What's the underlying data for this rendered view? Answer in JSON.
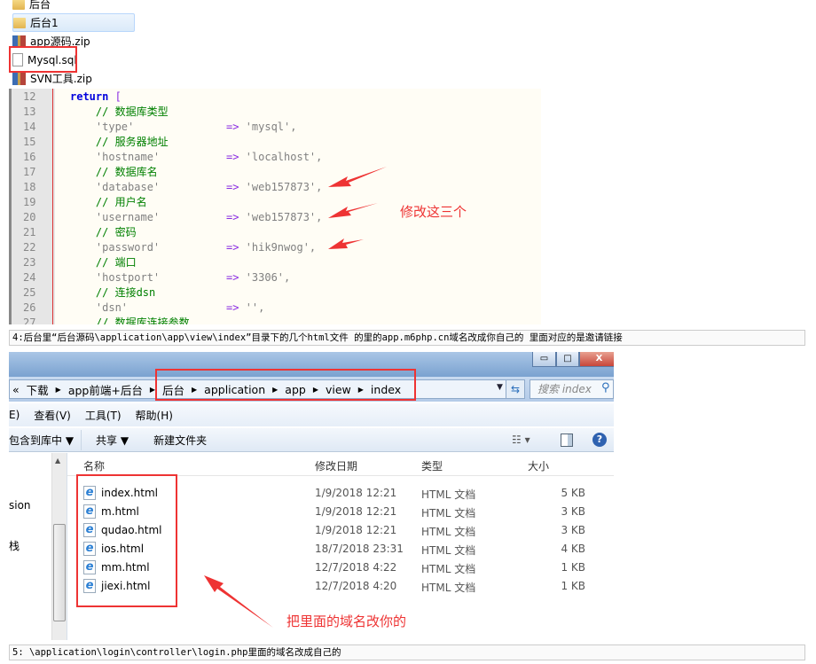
{
  "file_list": [
    {
      "name": "后台",
      "icon": "folder-icon"
    },
    {
      "name": "后台1",
      "icon": "folder-icon",
      "selected": true
    },
    {
      "name": "app源码.zip",
      "icon": "zip-icon"
    },
    {
      "name": "Mysql.sql",
      "icon": "file-icon",
      "highlighted": true
    },
    {
      "name": "SVN工具.zip",
      "icon": "zip-icon"
    }
  ],
  "code": {
    "lines": [
      {
        "n": "12",
        "t": "kw",
        "text": "return",
        "extra": " ["
      },
      {
        "n": "13",
        "t": "cm",
        "text": "    // 数据库类型"
      },
      {
        "n": "14",
        "t": "kv",
        "key": "    'type'",
        "val": "'mysql',"
      },
      {
        "n": "15",
        "t": "cm",
        "text": "    // 服务器地址"
      },
      {
        "n": "16",
        "t": "kv",
        "key": "    'hostname'",
        "val": "'localhost',"
      },
      {
        "n": "17",
        "t": "cm",
        "text": "    // 数据库名"
      },
      {
        "n": "18",
        "t": "kv",
        "key": "    'database'",
        "val": "'web157873',"
      },
      {
        "n": "19",
        "t": "cm",
        "text": "    // 用户名"
      },
      {
        "n": "20",
        "t": "kv",
        "key": "    'username'",
        "val": "'web157873',"
      },
      {
        "n": "21",
        "t": "cm",
        "text": "    // 密码"
      },
      {
        "n": "22",
        "t": "kv",
        "key": "    'password'",
        "val": "'hik9nwog',"
      },
      {
        "n": "23",
        "t": "cm",
        "text": "    // 端口"
      },
      {
        "n": "24",
        "t": "kv",
        "key": "    'hostport'",
        "val": "'3306',"
      },
      {
        "n": "25",
        "t": "cm",
        "text": "    // 连接dsn"
      },
      {
        "n": "26",
        "t": "kv",
        "key": "    'dsn'",
        "val": "'',"
      },
      {
        "n": "27",
        "t": "cm",
        "text": "    // 数据库连接参数"
      }
    ],
    "arrow_op": "=>",
    "annotation": "修改这三个"
  },
  "note4": "4:后台里“后台源码\\application\\app\\view\\index”目录下的几个html文件 的里的app.m6php.cn域名改成你自己的  里面对应的是邀请链接",
  "explorer": {
    "window_buttons": {
      "minimize": "▭",
      "maximize": "□",
      "close": "X"
    },
    "breadcrumb": [
      "«",
      "下载",
      "app前端+后台",
      "后台",
      "application",
      "app",
      "view",
      "index"
    ],
    "search_placeholder": "搜索 index",
    "menu": [
      "E)",
      "查看(V)",
      "工具(T)",
      "帮助(H)"
    ],
    "toolbar": {
      "include": "包含到库中 ▼",
      "share": "共享 ▼",
      "new_folder": "新建文件夹"
    },
    "nav_items": [
      "sion",
      "栈"
    ],
    "columns": [
      "名称",
      "修改日期",
      "类型",
      "大小"
    ],
    "files": [
      {
        "name": "index.html",
        "date": "1/9/2018 12:21",
        "type": "HTML 文档",
        "size": "5 KB"
      },
      {
        "name": "m.html",
        "date": "1/9/2018 12:21",
        "type": "HTML 文档",
        "size": "3 KB"
      },
      {
        "name": "qudao.html",
        "date": "1/9/2018 12:21",
        "type": "HTML 文档",
        "size": "3 KB"
      },
      {
        "name": "ios.html",
        "date": "18/7/2018 23:31",
        "type": "HTML 文档",
        "size": "4 KB"
      },
      {
        "name": "mm.html",
        "date": "12/7/2018 4:22",
        "type": "HTML 文档",
        "size": "1 KB"
      },
      {
        "name": "jiexi.html",
        "date": "12/7/2018 4:20",
        "type": "HTML 文档",
        "size": "1 KB"
      }
    ],
    "annotation": "把里面的域名改你的"
  },
  "note5": "5: \\application\\login\\controller\\login.php里面的域名改成自己的",
  "colors": {
    "annotation": "#ee3333"
  }
}
